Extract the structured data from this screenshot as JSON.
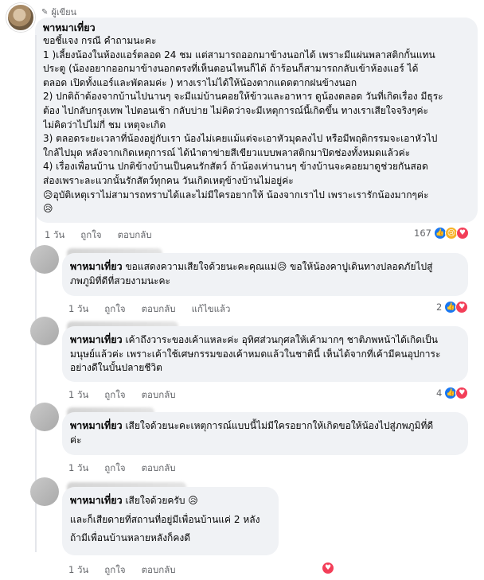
{
  "post": {
    "author_badge": "ผู้เขียน",
    "name": "พาหมาเที่ยว",
    "lines": [
      "ขอชี้แจง กรณี คำถามนะคะ",
      "1 )เลี้ยงน้องในห้องแอร์ตลอด 24 ชม แต่สามารถออกมาข้างนอกได้ เพราะมีแผ่นพลาสติกกั้นแทน",
      "ประตู (น้องอยากออกมาข้างนอกตรงที่เห็นตอนไหนก็ได้ ถ้าร้อนก็สามารถกลับเข้าห้องแอร์ ได้",
      "ตลอด เปิดทั้งแอร์และพัดลมค่ะ ) ทางเราไม่ได้ให้น้องตากแดดตากฝนข้างนอก",
      "2) ปกติถ้าต้องจากบ้านไปนานๆ จะมีแม่บ้านคอยให้ข้าวและอาหาร ดูน้องตลอด วันที่เกิดเรื่อง มีธุระ",
      "ต้อง ไปกลับกรุงเทพ ไปตอนเช้า กลับบ่าย ไม่คิดว่าจะมีเหตุการณ์นี้เกิดขึ้น ทางเราเสียใจจริงๆค่ะ",
      "ไม่คิดว่าไปไม่กี่ ชม เหตุจะเกิด",
      "3) ตลอดระยะเวลาที่น้องอยู่กับเรา น้องไม่เคยแม้แต่จะเอาหัวมุดลงไป หรือมีพฤติกรรมจะเอาหัวไป",
      "ใกล้ไปมุด หลังจากเกิดเหตุการณ์ ได้นำตาข่ายสีเขียวแบบพลาสติกมาปิดช่องทั้งหมดแล้วค่ะ",
      "4) เรื่องเพื่อนบ้าน ปกติข้างบ้านเป็นคนรักสัตว์ ถ้าน้องเห่านานๆ ข้างบ้านจะคอยมาดูช่วยกันสอด",
      "ส่องเพราะละแวกนั้นรักสัตว์ทุกคน วันเกิดเหตุข้างบ้านไม่อยู่ค่ะ",
      "😥อุบัติเหตุเราไม่สามารถทราบได้และไม่มีใครอยากให้ น้องจากเราไป เพราะเรารักน้องมากๆค่ะ",
      "😥"
    ],
    "time": "1 วัน",
    "like": "ถูกใจ",
    "reply": "ตอบกลับ",
    "reaction_count": "167"
  },
  "replies": [
    {
      "name": "พาหมาเที่ยว",
      "lines": [
        "ขอแสดงความเสียใจด้วยนะคะคุณแม่😥 ขอให้น้องคาปูเดินทางปลอดภัยไปสู่",
        "ภพภูมิที่ดีที่สวยงามนะคะ"
      ],
      "time": "1 วัน",
      "like": "ถูกใจ",
      "reply": "ตอบกลับ",
      "edited": "แก้ไขแล้ว",
      "reaction_count": "2"
    },
    {
      "name": "พาหมาเที่ยว",
      "lines": [
        "เค้าถึงวาระของเค้าแหละค่ะ อุทิศส่วนกุศลให้เค้ามากๆ ชาติภพหน้าได้เกิดเป็น",
        "มนุษย์แล้วค่ะ เพราะเค้าใช้เศษกรรมของเค้าหมดแล้วในชาตินี้ เห็นได้จากที่เค้ามีคนอุปการะ",
        "อย่างดีในบั้นปลายชีวิต"
      ],
      "time": "1 วัน",
      "like": "ถูกใจ",
      "reply": "ตอบกลับ",
      "reaction_count": "4"
    },
    {
      "name": "พาหมาเที่ยว",
      "lines": [
        "เสียใจด้วยนะคะเหตุการณ์แบบนี้ไม่มีใครอยากให้เกิดขอให้น้องไปสู่ภพภูมิที่ดี",
        "ค่ะ"
      ],
      "time": "1 วัน",
      "like": "ถูกใจ",
      "reply": "ตอบกลับ"
    },
    {
      "name": "พาหมาเที่ยว",
      "lines": [
        "เสียใจด้วยครับ 😥",
        "และก็เสียดายที่สถานที่อยู่มีเพื่อนบ้านแค่ 2 หลัง",
        "ถ้ามีเพื่อนบ้านหลายหลังก็คงดี"
      ],
      "time": "1 วัน",
      "like": "ถูกใจ",
      "reply": "ตอบกลับ"
    }
  ],
  "icons": {
    "like": "like-reaction-icon",
    "love": "love-reaction-icon",
    "sad": "sad-reaction-icon"
  }
}
